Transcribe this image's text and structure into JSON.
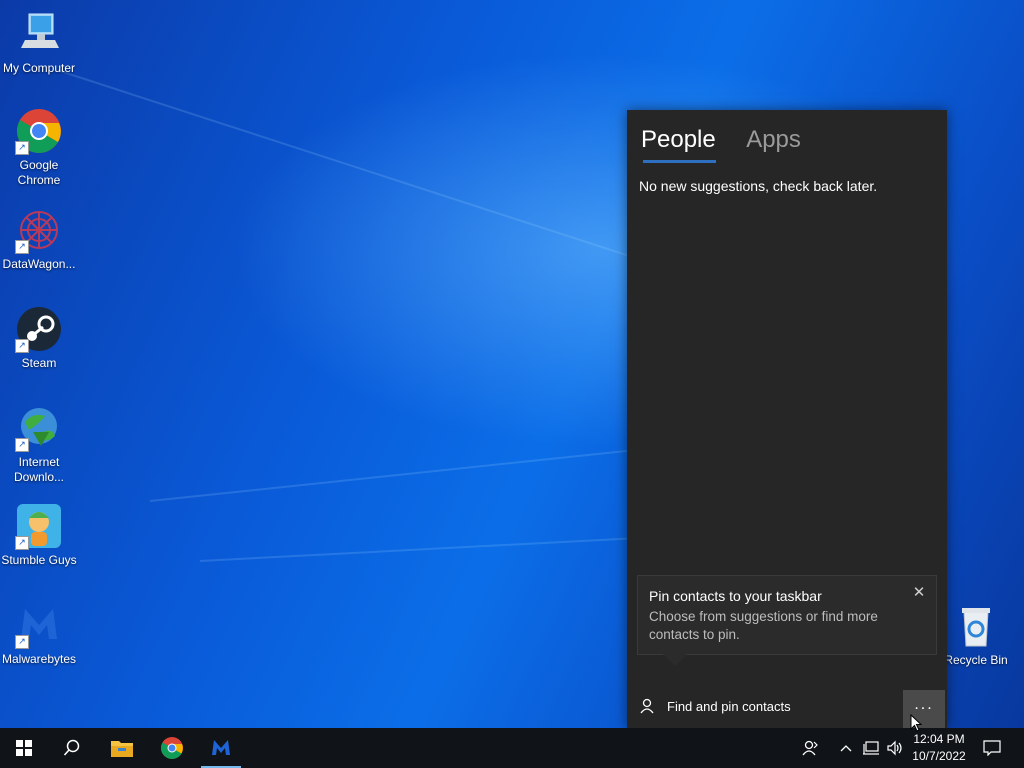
{
  "desktop": {
    "icons": [
      {
        "label": "My Computer"
      },
      {
        "label": "Google Chrome"
      },
      {
        "label": "DataWagon..."
      },
      {
        "label": "Steam"
      },
      {
        "label": "Internet Downlo..."
      },
      {
        "label": "Stumble Guys"
      },
      {
        "label": "Malwarebytes"
      }
    ],
    "recycle_bin": "Recycle Bin"
  },
  "people_panel": {
    "tabs": [
      "People",
      "Apps"
    ],
    "active_tab": "People",
    "message": "No new suggestions, check back later.",
    "tip": {
      "title": "Pin contacts to your taskbar",
      "body": "Choose from suggestions or find more contacts to pin."
    },
    "find_pin_label": "Find and pin contacts",
    "more_label": "..."
  },
  "taskbar": {
    "time": "12:04 PM",
    "date": "10/7/2022",
    "pinned": [
      "start-icon",
      "search-icon",
      "file-explorer-icon",
      "chrome-icon",
      "malwarebytes-icon"
    ],
    "tray": [
      "people-icon",
      "chevron-up-icon",
      "network-icon",
      "volume-icon",
      "notification-icon"
    ]
  },
  "colors": {
    "panel_bg": "#262626",
    "tab_underline": "#2f6fbf",
    "taskbar_bg": "#101418"
  }
}
